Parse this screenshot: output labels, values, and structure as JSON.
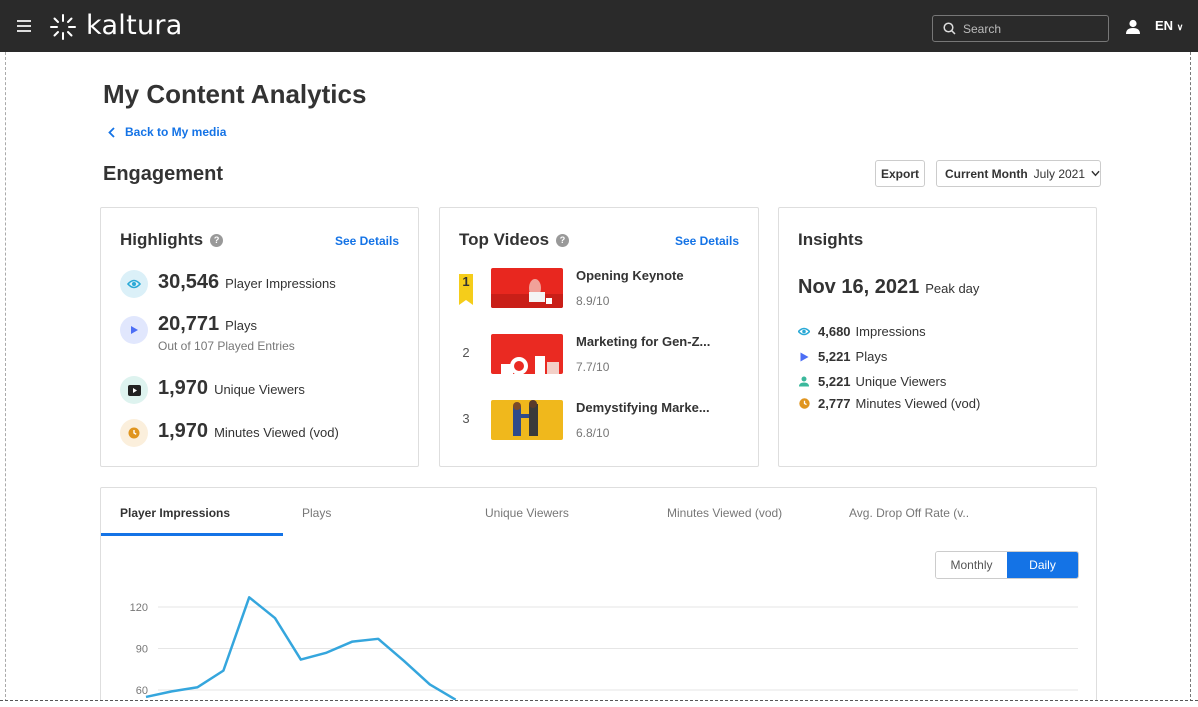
{
  "app": {
    "logo_text": "kaltura",
    "search_placeholder": "Search",
    "language": "EN"
  },
  "page": {
    "title": "My Content Analytics",
    "back_link": "Back to My media",
    "section_title": "Engagement",
    "export_label": "Export",
    "period_label": "Current Month",
    "period_value": "July 2021"
  },
  "highlights": {
    "title": "Highlights",
    "see_details": "See Details",
    "items": [
      {
        "value": "30,546",
        "label": "Player Impressions",
        "icon": "eye-icon",
        "color": "#2aa9d6",
        "bg": "#dbf0f8"
      },
      {
        "value": "20,771",
        "label": "Plays",
        "sub": "Out of 107 Played Entries",
        "icon": "play-icon",
        "color": "#4c6ef5",
        "bg": "#e1e7fd"
      },
      {
        "value": "1,970",
        "label": "Unique Viewers",
        "icon": "play-box-icon",
        "color": "#222222",
        "bg": "#def3ef"
      },
      {
        "value": "1,970",
        "label": "Minutes Viewed (vod)",
        "icon": "clock-icon",
        "color": "#e0951f",
        "bg": "#fbefdc"
      }
    ]
  },
  "top_videos": {
    "title": "Top Videos",
    "see_details": "See Details",
    "items": [
      {
        "rank": "1",
        "name": "Opening Keynote",
        "score": "8.9/10"
      },
      {
        "rank": "2",
        "name": "Marketing for Gen-Z...",
        "score": "7.7/10"
      },
      {
        "rank": "3",
        "name": "Demystifying Marke...",
        "score": "6.8/10"
      }
    ]
  },
  "insights": {
    "title": "Insights",
    "peak_date": "Nov 16, 2021",
    "peak_label": "Peak day",
    "items": [
      {
        "value": "4,680",
        "label": "Impressions",
        "icon": "eye-icon",
        "color": "#2aa9d6"
      },
      {
        "value": "5,221",
        "label": "Plays",
        "icon": "play-icon",
        "color": "#4c6ef5"
      },
      {
        "value": "5,221",
        "label": "Unique Viewers",
        "icon": "user-icon",
        "color": "#3bb89c"
      },
      {
        "value": "2,777",
        "label": "Minutes Viewed (vod)",
        "icon": "clock-icon",
        "color": "#e0951f"
      }
    ]
  },
  "chart_tabs": [
    "Player Impressions",
    "Plays",
    "Unique Viewers",
    "Minutes Viewed (vod)",
    "Avg. Drop Off Rate (v.."
  ],
  "granularity": {
    "monthly": "Monthly",
    "daily": "Daily",
    "selected": "Daily"
  },
  "chart_data": {
    "type": "line",
    "series_color": "#35a6dd",
    "ylim": [
      60,
      120
    ],
    "yticks": [
      "120",
      "90",
      "60"
    ],
    "values": [
      55,
      59,
      62,
      74,
      127,
      112,
      82,
      87,
      95,
      97,
      81,
      64,
      53
    ]
  }
}
